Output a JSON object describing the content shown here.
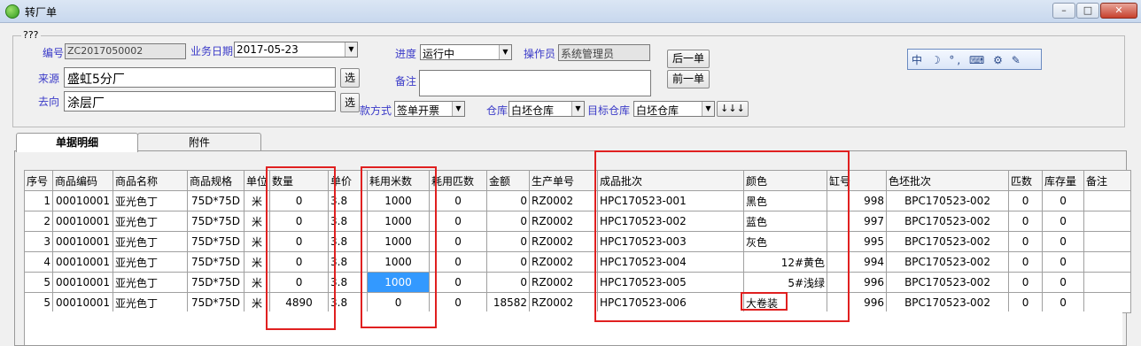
{
  "window": {
    "title": "转厂单",
    "minimize": "–",
    "maximize": "□",
    "close": "✕"
  },
  "form": {
    "group_title": "???",
    "number": {
      "label": "编号",
      "value": "ZC2017050002"
    },
    "date": {
      "label": "业务日期",
      "value": "2017-05-23"
    },
    "progress": {
      "label": "进度",
      "value": "运行中"
    },
    "operator": {
      "label": "操作员",
      "value": "系统管理员"
    },
    "source": {
      "label": "来源",
      "value": "盛虹5分厂",
      "button": "选"
    },
    "dest": {
      "label": "去向",
      "value": "涂层厂",
      "button": "选"
    },
    "remark": {
      "label": "备注",
      "value": ""
    },
    "payment": {
      "label": "款方式",
      "value": "签单开票"
    },
    "warehouse": {
      "label": "仓库",
      "value": "白坯仓库"
    },
    "target_warehouse": {
      "label": "目标仓库",
      "value": "白坯仓库"
    },
    "arrows": "↓↓↓",
    "next_button": "后一单",
    "prev_button": "前一单"
  },
  "ime_bar": "中 ☽ °, ⌨ ⚙ ✎",
  "tabs": [
    {
      "label": "单据明细"
    },
    {
      "label": "附件"
    }
  ],
  "grid": {
    "columns": [
      "序号",
      "商品编码",
      "商品名称",
      "商品规格",
      "单位",
      "数量",
      "单价",
      "耗用米数",
      "耗用匹数",
      "金额",
      "生产单号",
      "成品批次",
      "颜色",
      "缸号",
      "色坯批次",
      "匹数",
      "库存量",
      "备注"
    ],
    "rows": [
      [
        "1",
        "00010001",
        "亚光色丁",
        "75D*75D",
        "米",
        "0",
        "3.8",
        "1000",
        "0",
        "0",
        "RZ0002",
        "HPC170523-001",
        "黑色",
        "998",
        "BPC170523-002",
        "0",
        "0",
        ""
      ],
      [
        "2",
        "00010001",
        "亚光色丁",
        "75D*75D",
        "米",
        "0",
        "3.8",
        "1000",
        "0",
        "0",
        "RZ0002",
        "HPC170523-002",
        "蓝色",
        "997",
        "BPC170523-002",
        "0",
        "0",
        ""
      ],
      [
        "3",
        "00010001",
        "亚光色丁",
        "75D*75D",
        "米",
        "0",
        "3.8",
        "1000",
        "0",
        "0",
        "RZ0002",
        "HPC170523-003",
        "灰色",
        "995",
        "BPC170523-002",
        "0",
        "0",
        ""
      ],
      [
        "4",
        "00010001",
        "亚光色丁",
        "75D*75D",
        "米",
        "0",
        "3.8",
        "1000",
        "0",
        "0",
        "RZ0002",
        "HPC170523-004",
        "12#黄色",
        "994",
        "BPC170523-002",
        "0",
        "0",
        ""
      ],
      [
        "5",
        "00010001",
        "亚光色丁",
        "75D*75D",
        "米",
        "0",
        "3.8",
        "1000",
        "0",
        "0",
        "RZ0002",
        "HPC170523-005",
        "5#浅绿",
        "996",
        "BPC170523-002",
        "0",
        "0",
        ""
      ],
      [
        "5",
        "00010001",
        "亚光色丁",
        "75D*75D",
        "米",
        "4890",
        "3.8",
        "0",
        "0",
        "18582",
        "RZ0002",
        "HPC170523-006",
        "大卷装",
        "996",
        "BPC170523-002",
        "0",
        "0",
        ""
      ]
    ]
  }
}
